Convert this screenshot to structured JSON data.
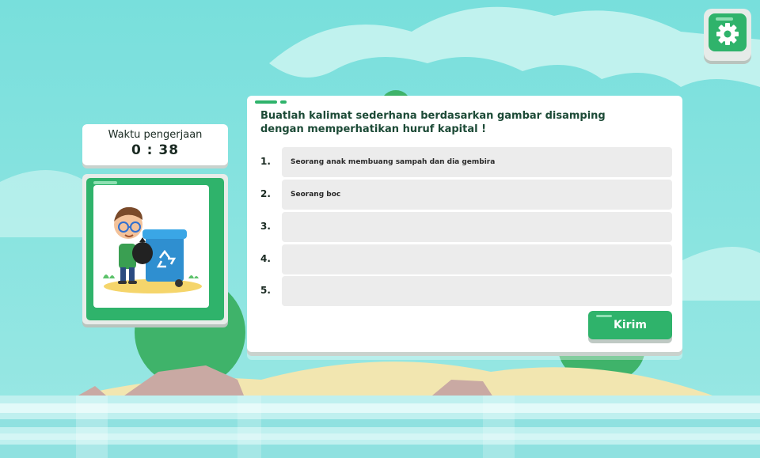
{
  "timer": {
    "label": "Waktu pengerjaan",
    "value": "0 : 38"
  },
  "question": {
    "text": "Buatlah kalimat sederhana berdasarkan gambar disamping dengan memperhatikan huruf kapital !"
  },
  "answers": [
    {
      "number": "1.",
      "value": "Seorang anak membuang sampah dan dia gembira"
    },
    {
      "number": "2.",
      "value": "Seorang boc"
    },
    {
      "number": "3.",
      "value": ""
    },
    {
      "number": "4.",
      "value": ""
    },
    {
      "number": "5.",
      "value": ""
    }
  ],
  "submit_label": "Kirim",
  "icons": {
    "settings": "gear-icon",
    "picture": "boy-recycling-trash-illustration"
  },
  "colors": {
    "accent": "#2fb36b",
    "sky": "#7fe0e0",
    "text_dark": "#1c4a36"
  }
}
